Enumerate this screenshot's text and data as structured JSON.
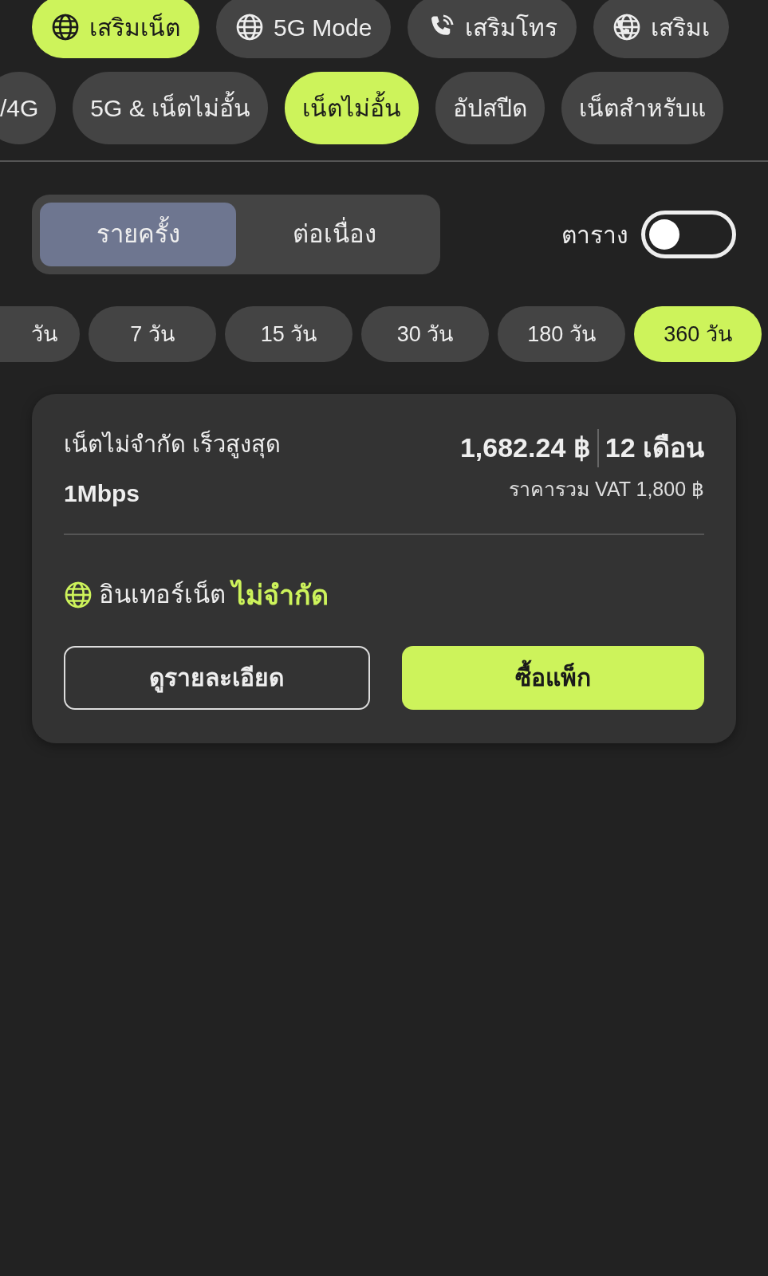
{
  "categories": [
    {
      "label": "เสริมเน็ต",
      "kind": "globe",
      "selected": true
    },
    {
      "label": "5G Mode",
      "kind": "globe",
      "selected": false
    },
    {
      "label": "เสริมโทร",
      "kind": "phone",
      "selected": false
    },
    {
      "label": "เสริมเ",
      "kind": "globe-phone",
      "selected": false
    }
  ],
  "plan_types": [
    {
      "label": "/4G",
      "selected": false
    },
    {
      "label": "5G & เน็ตไม่อั้น",
      "selected": false
    },
    {
      "label": "เน็ตไม่อั้น",
      "selected": true
    },
    {
      "label": "อัปสปีด",
      "selected": false
    },
    {
      "label": "เน็ตสำหรับแ",
      "selected": false
    }
  ],
  "billing_tabs": [
    {
      "label": "รายครั้ง",
      "selected": true
    },
    {
      "label": "ต่อเนื่อง",
      "selected": false
    }
  ],
  "schedule_toggle": {
    "label": "ตาราง",
    "on": false
  },
  "durations": [
    {
      "label": "วัน",
      "selected": false
    },
    {
      "label": "7 วัน",
      "selected": false
    },
    {
      "label": "15 วัน",
      "selected": false
    },
    {
      "label": "30 วัน",
      "selected": false
    },
    {
      "label": "180 วัน",
      "selected": false
    },
    {
      "label": "360 วัน",
      "selected": true
    }
  ],
  "package": {
    "title": "เน็ตไม่จำกัด เร็วสูงสุด",
    "speed": "1Mbps",
    "price": "1,682.24 ฿",
    "duration": "12 เดือน",
    "vat_price": "ราคารวม VAT 1,800 ฿",
    "feature": {
      "label": "อินเทอร์เน็ต",
      "value": "ไม่จำกัด"
    },
    "buttons": [
      {
        "label": "ดูรายละเอียด",
        "kind": "outline"
      },
      {
        "label": "ซื้อแพ็ก",
        "kind": "primary"
      }
    ]
  }
}
